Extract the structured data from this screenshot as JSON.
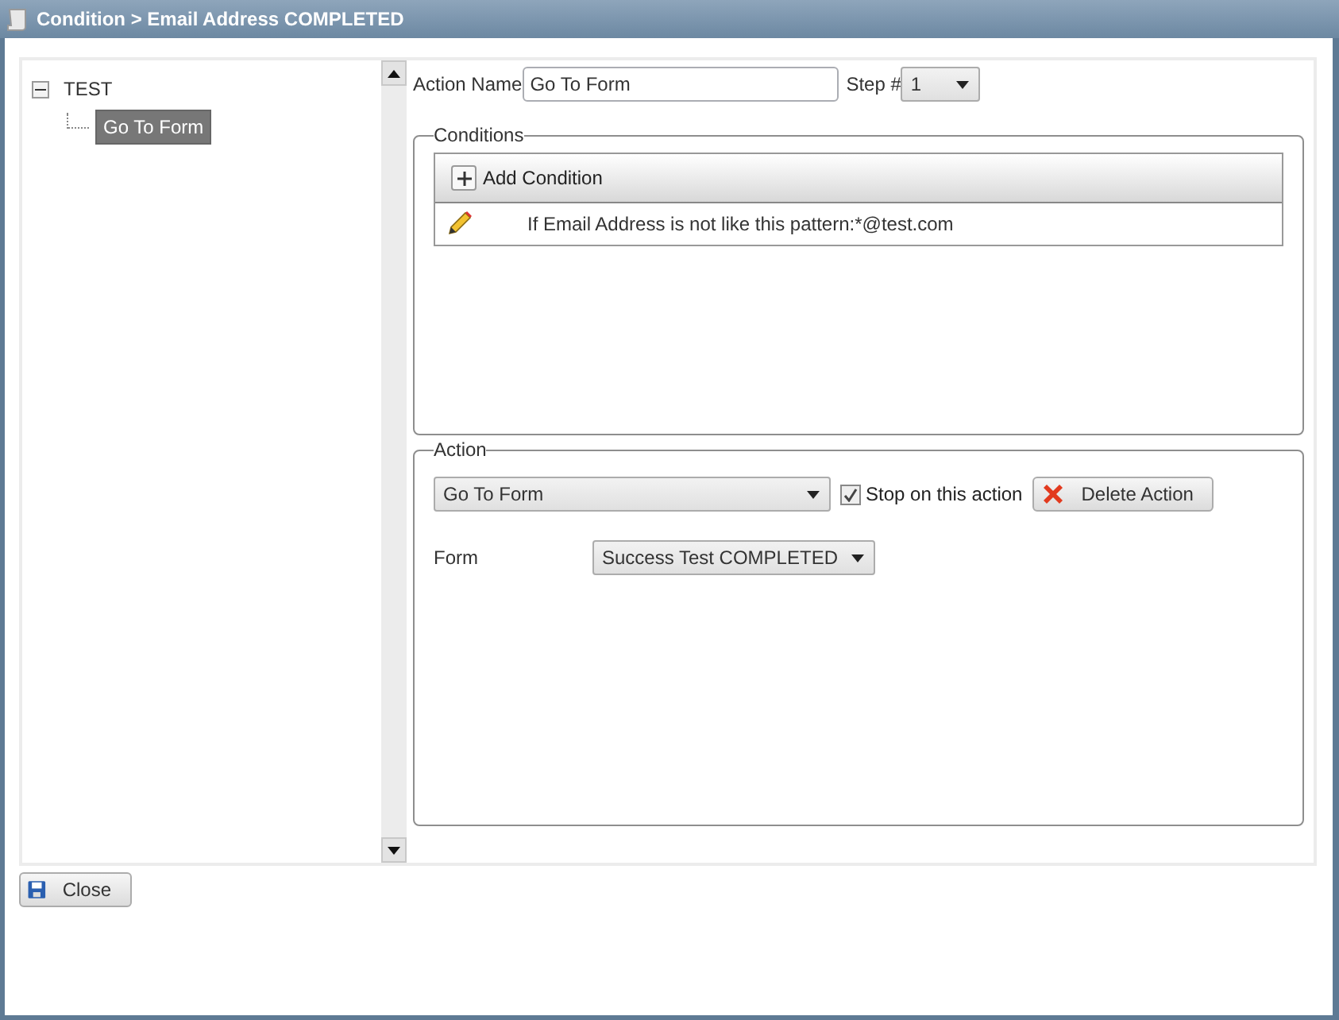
{
  "window": {
    "title": "Condition > Email Address COMPLETED"
  },
  "tree": [
    {
      "label": "TEST",
      "expanded": true,
      "selected": false,
      "children": [
        {
          "label": "Go To Form",
          "selected": true
        }
      ]
    }
  ],
  "action_name": {
    "label": "Action Name",
    "value": "Go To Form"
  },
  "step": {
    "label": "Step #",
    "value": "1"
  },
  "conditions": {
    "legend": "Conditions",
    "add_button": "Add Condition",
    "rows": [
      {
        "text": "If Email Address is not like this pattern:*@test.com"
      }
    ]
  },
  "action": {
    "legend": "Action",
    "type": "Go To Form",
    "stop": {
      "label": "Stop on this action",
      "checked": true
    },
    "delete_button": "Delete Action",
    "form_label": "Form",
    "form_value": "Success Test COMPLETED"
  },
  "close_button": "Close"
}
